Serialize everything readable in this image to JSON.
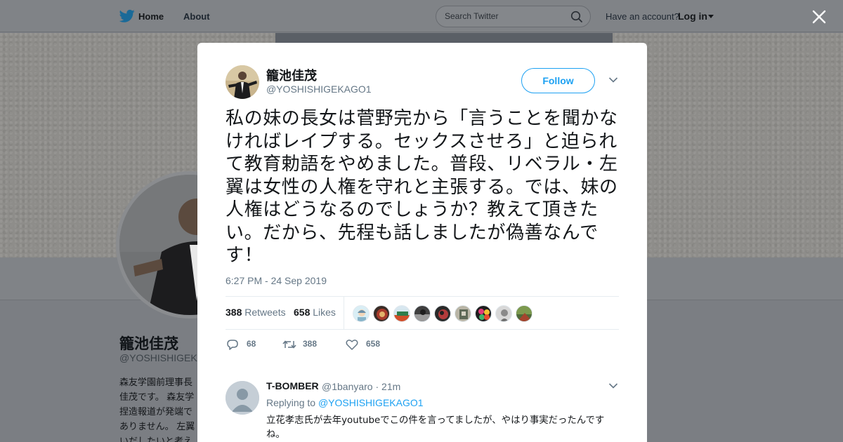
{
  "nav": {
    "home_label": "Home",
    "about_label": "About",
    "search_placeholder": "Search Twitter",
    "have_account": "Have an account?",
    "login_label": "Log in"
  },
  "background_profile": {
    "name": "籠池佳茂",
    "handle": "@YOSHISHIGEKA",
    "bio_lines": [
      "森友学園前理事長",
      "佳茂です。 森友学",
      "捏造報道が発端で",
      "ありません。 左翼",
      "いだしたいと考え"
    ]
  },
  "tweet": {
    "author_name": "籠池佳茂",
    "author_handle": "@YOSHISHIGEKAGO1",
    "follow_label": "Follow",
    "text": "私の妹の長女は菅野完から「言うことを聞かなければレイプする。セックスさせろ」と迫られて教育勅語をやめました。普段、リベラル・左翼は女性の人権を守れと主張する。では、妹の人権はどうなるのでしょうか？教えて頂きたい。だから、先程も話しましたが偽善なんです！",
    "timestamp": "6:27 PM - 24 Sep 2019",
    "retweets_count": "388",
    "retweets_label": "Retweets",
    "likes_count": "658",
    "likes_label": "Likes",
    "reply_action_count": "68",
    "retweet_action_count": "388",
    "like_action_count": "658"
  },
  "reply": {
    "name": "T-BOMBER",
    "handle": "@1banyaro",
    "time": "· 21m",
    "replying_prefix": "Replying to",
    "replying_to": "@YOSHISHIGEKAGO1",
    "text": "立花孝志氏が去年youtubeでこの件を言ってましたが、やはり事実だったんですね。"
  },
  "colors": {
    "accent": "#1da1f2",
    "secondary_text": "#657786",
    "primary_text": "#14171a"
  }
}
